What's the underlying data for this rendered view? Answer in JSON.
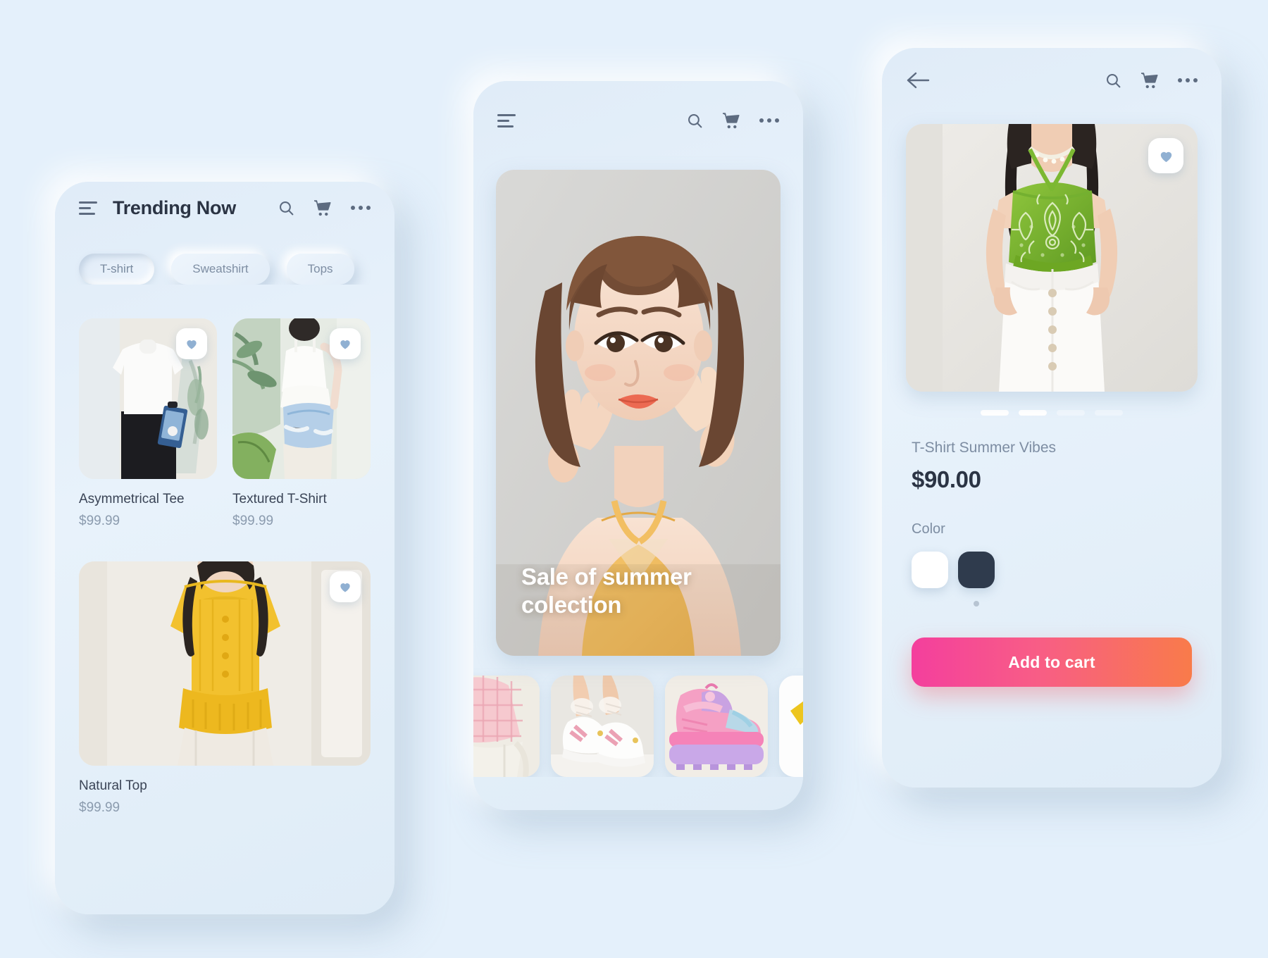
{
  "theme": {
    "background": "#e4f0fb",
    "text_dark": "#2b3444",
    "text_muted": "#8b9bae",
    "heart_color": "#90b0d2",
    "cta_gradient_start": "#f43f9d",
    "cta_gradient_end": "#f97b4a"
  },
  "screen1": {
    "nav": {
      "menu_icon": "hamburger-icon",
      "title": "Trending Now",
      "search_icon": "search-icon",
      "cart_icon": "cart-icon",
      "more_icon": "more-dots-icon"
    },
    "chips": [
      {
        "label": "T-shirt",
        "active": true
      },
      {
        "label": "Sweatshirt",
        "active": false
      },
      {
        "label": "Tops",
        "active": false
      }
    ],
    "products": [
      {
        "name": "Asymmetrical Tee",
        "price": "$99.99",
        "favorite_icon": "heart-icon"
      },
      {
        "name": "Textured T-Shirt",
        "price": "$99.99",
        "favorite_icon": "heart-icon"
      },
      {
        "name": "Natural Top",
        "price": "$99.99",
        "favorite_icon": "heart-icon"
      }
    ]
  },
  "screen2": {
    "nav": {
      "menu_icon": "hamburger-icon",
      "search_icon": "search-icon",
      "cart_icon": "cart-icon",
      "more_icon": "more-dots-icon"
    },
    "hero": {
      "caption": "Sale of summer colection"
    },
    "thumbnails": [
      {
        "name": "pink-gingham-top-thumbnail"
      },
      {
        "name": "white-pink-sneakers-thumbnail"
      },
      {
        "name": "platform-sneaker-thumbnail"
      },
      {
        "name": "yellow-shirt-thumbnail"
      }
    ]
  },
  "screen3": {
    "nav": {
      "back_icon": "back-arrow-icon",
      "search_icon": "search-icon",
      "cart_icon": "cart-icon",
      "more_icon": "more-dots-icon"
    },
    "gallery": {
      "favorite_icon": "heart-icon",
      "pager": [
        {
          "active": true
        },
        {
          "active": true
        },
        {
          "active": false
        },
        {
          "active": false
        }
      ]
    },
    "product": {
      "name": "T-Shirt Summer Vibes",
      "price": "$90.00",
      "color_label": "Color",
      "colors": [
        {
          "hex": "#ffffff",
          "selected": false
        },
        {
          "hex": "#2f3b4d",
          "selected": true
        }
      ]
    },
    "cta": {
      "label": "Add to cart"
    }
  }
}
